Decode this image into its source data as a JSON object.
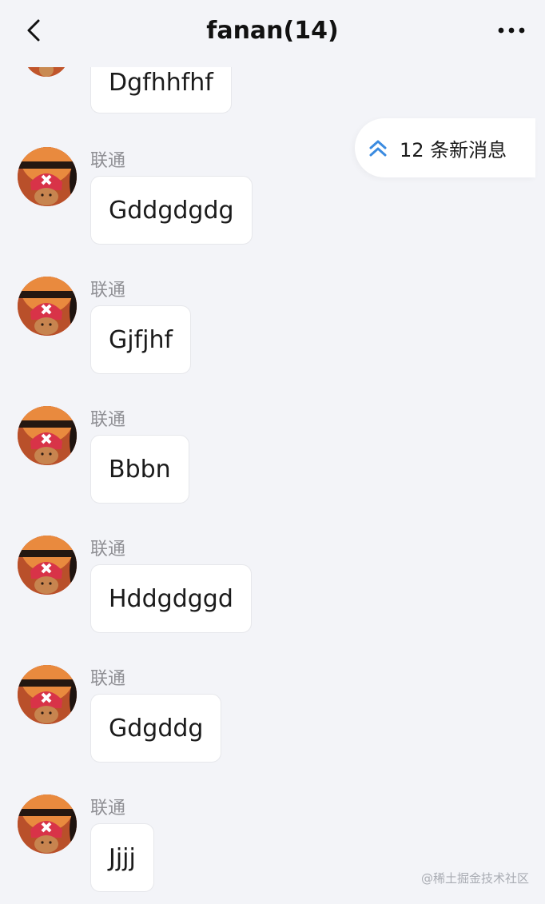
{
  "header": {
    "title": "fanan(14)",
    "back_icon": "chevron-left-icon",
    "more_icon": "more-horizontal-icon"
  },
  "new_messages_pill": {
    "icon": "double-chevron-up-icon",
    "text": "12 条新消息",
    "icon_color": "#3b8be0"
  },
  "messages": [
    {
      "sender": "",
      "text": "Dgfhhfhf",
      "avatar": "avatar-image",
      "partial": true
    },
    {
      "sender": "联通",
      "text": "Gddgdgdg",
      "avatar": "avatar-image"
    },
    {
      "sender": "联通",
      "text": "Gjfjhf",
      "avatar": "avatar-image"
    },
    {
      "sender": "联通",
      "text": "Bbbn",
      "avatar": "avatar-image"
    },
    {
      "sender": "联通",
      "text": "Hddgdggd",
      "avatar": "avatar-image"
    },
    {
      "sender": "联通",
      "text": "Gdgddg",
      "avatar": "avatar-image"
    },
    {
      "sender": "联通",
      "text": "Jjjj",
      "avatar": "avatar-image"
    }
  ],
  "watermark": "@稀土掘金技术社区",
  "colors": {
    "background": "#f3f4f8",
    "bubble": "#ffffff",
    "sender_text": "#8f8f94",
    "accent": "#3b8be0"
  }
}
